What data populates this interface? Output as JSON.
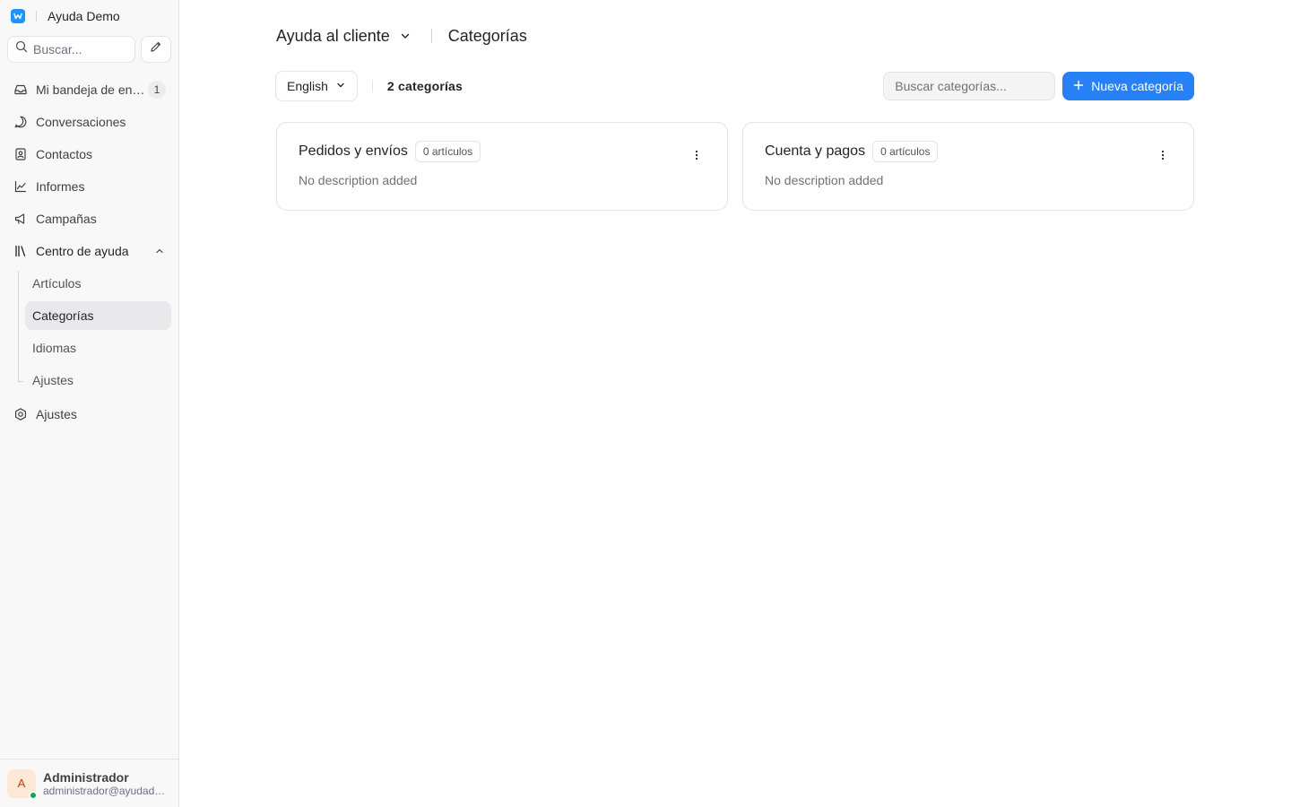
{
  "app": {
    "name": "Ayuda Demo",
    "brand_color": "#1f93ff"
  },
  "sidebar": {
    "search_placeholder": "Buscar...",
    "nav": {
      "inbox": {
        "label": "Mi bandeja de entrada",
        "badge": "1",
        "icon": "inbox-icon"
      },
      "conversations": {
        "label": "Conversaciones",
        "icon": "message-circle-icon"
      },
      "contacts": {
        "label": "Contactos",
        "icon": "contact-book-icon"
      },
      "reports": {
        "label": "Informes",
        "icon": "chart-line-icon"
      },
      "campaigns": {
        "label": "Campañas",
        "icon": "megaphone-icon"
      },
      "help_center": {
        "label": "Centro de ayuda",
        "icon": "library-icon",
        "children": [
          {
            "label": "Artículos"
          },
          {
            "label": "Categorías",
            "active": true
          },
          {
            "label": "Idiomas"
          },
          {
            "label": "Ajustes"
          }
        ]
      },
      "settings": {
        "label": "Ajustes",
        "icon": "gear-icon"
      }
    },
    "profile": {
      "initial": "A",
      "name": "Administrador",
      "email": "administrador@ayudademo.com",
      "status_color": "#16a34a"
    }
  },
  "header": {
    "portal_name": "Ayuda al cliente",
    "page_title": "Categorías"
  },
  "toolbar": {
    "language": "English",
    "category_count": "2 categorías",
    "search_placeholder": "Buscar categorías...",
    "new_button_label": "Nueva categoría",
    "accent_color": "#2781f6"
  },
  "categories": [
    {
      "title": "Pedidos y envíos",
      "badge": "0 artículos",
      "description": "No description added"
    },
    {
      "title": "Cuenta y pagos",
      "badge": "0 artículos",
      "description": "No description added"
    }
  ]
}
